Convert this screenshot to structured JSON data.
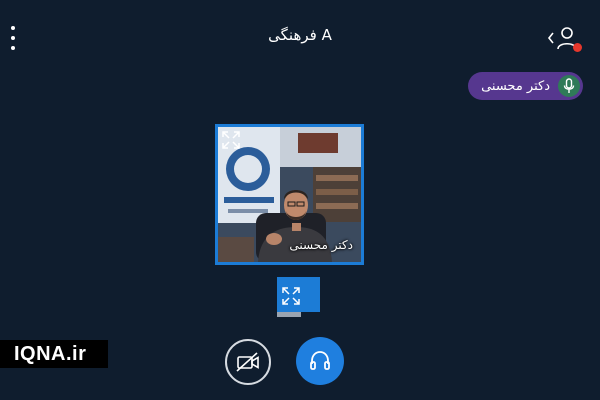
{
  "header": {
    "room_title": "A فرهنگی",
    "menu_icon": "vertical-ellipsis-icon",
    "users_icon": "user-icon",
    "notification_color": "#e5372c"
  },
  "talking_indicator": {
    "name": "دکتر محسنی",
    "mic_icon": "microphone-icon",
    "pill_color": "#56378f",
    "mic_bg_color": "#2f7a58"
  },
  "video_tile": {
    "name": "دکتر محسنی",
    "border_color": "#1c7cd6",
    "expand_icon": "expand-arrows-icon"
  },
  "presentation": {
    "icon": "expand-arrows-icon"
  },
  "watermark": {
    "text": "IQNA.ir"
  },
  "controls": {
    "video_icon": "video-off-icon",
    "audio_icon": "headphones-icon",
    "audio_color": "#1f7fdf"
  },
  "theme": {
    "background": "#0f1d2e",
    "accent": "#1c7cd6"
  }
}
